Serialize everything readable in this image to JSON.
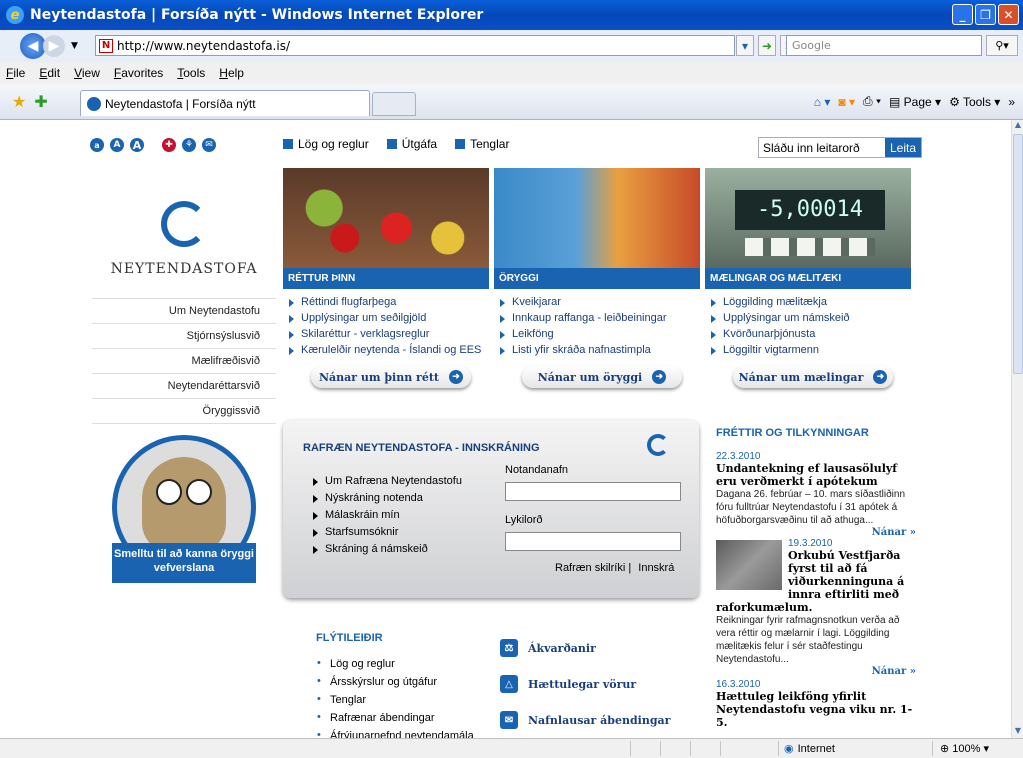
{
  "window": {
    "title": "Neytendastofa | Forsíða nýtt - Windows Internet Explorer",
    "ie_icon": "e"
  },
  "address": {
    "url": "http://www.neytendastofa.is/",
    "search_placeholder": "Google"
  },
  "menu": [
    "File",
    "Edit",
    "View",
    "Favorites",
    "Tools",
    "Help"
  ],
  "tab": {
    "title": "Neytendastofa | Forsíða nýtt"
  },
  "commandbar": {
    "page": "Page",
    "tools": "Tools"
  },
  "status": {
    "zone": "Internet",
    "zoom": "100%"
  },
  "site": {
    "accessibility_icons": [
      "a",
      "A",
      "A"
    ],
    "top_links": [
      "Lög og reglur",
      "Útgáfa",
      "Tenglar"
    ],
    "search_placeholder": "Sláðu inn leitarorð",
    "search_button": "Leita",
    "logo_name": "NEYTENDASTOFA",
    "sidenav": [
      "Um Neytendastofu",
      "Stjórnsýslusvið",
      "Mælifræðisvið",
      "Neytendaréttarsvið",
      "Öryggissvið"
    ],
    "owl_banner": "Smelltu til að kanna öryggi vefverslana",
    "columns": [
      {
        "head": "RÉTTUR ÞINN",
        "items": [
          "Réttindi flugfarþega",
          "Upplýsingar um seðilgjöld",
          "Skilaréttur - verklagsreglur",
          "Kærulelðir neytenda - Íslandi og EES"
        ],
        "more": "Nánar um þinn rétt"
      },
      {
        "head": "ÖRYGGI",
        "items": [
          "Kveikjarar",
          "Innkaup raffanga - leiðbeiningar",
          "Leikföng",
          "Listi yfir skráða nafnastimpla"
        ],
        "more": "Nánar um öryggi"
      },
      {
        "head": "MÆLINGAR OG MÆLITÆKI",
        "items": [
          "Löggilding mælitækja",
          "Upplýsingar um námskeið",
          "Kvörðunarþjónusta",
          "Löggiltir vigtarmenn"
        ],
        "more": "Nánar um mælingar"
      }
    ],
    "photo3_reading": "-5,00014",
    "login": {
      "title": "RAFRÆN NEYTENDASTOFA - INNSKRÁNING",
      "links": [
        "Um Rafræna Neytendastofu",
        "Nýskráning notenda",
        "Málaskráin mín",
        "Starfsumsóknir",
        "Skráning á námskeið"
      ],
      "user_label": "Notandanafn",
      "pass_label": "Lykilorð",
      "cert_link": "Rafræn skilríki |",
      "login_link": "Innskrá"
    },
    "shortcuts": {
      "title": "FLÝTILEIÐIR",
      "items": [
        "Lög og reglur",
        "Ársskýrslur og útgáfur",
        "Tenglar",
        "Rafrænar ábendingar",
        "Áfrýjunarnefnd neytendamála"
      ],
      "icons": [
        "Ákvarðanir",
        "Hættulegar vörur",
        "Nafnlausar ábendingar"
      ]
    },
    "news": {
      "title": "FRÉTTIR OG TILKYNNINGAR",
      "more": "Nánar »",
      "items": [
        {
          "date": "22.3.2010",
          "headline": "Undantekning ef lausasölulyf eru verðmerkt í apótekum",
          "body": "Dagana 26. febrúar – 10. mars síðastliðinn fóru fulltrúar Neytendastofu í 31 apótek á höfuðborgarsvæðinu til að athuga..."
        },
        {
          "date": "19.3.2010",
          "headline": "Orkubú Vestfjarða fyrst til að fá viðurkenninguna á innra eftirliti með raforkumælum.",
          "body": "Reikningar fyrir rafmagnsnotkun verða að vera réttir og mælarnir í lagi. Löggilding mælitækis felur í sér staðfestingu Neytendastofu..."
        },
        {
          "date": "16.3.2010",
          "headline": "Hættuleg leikföng yfirlit Neytendastofu vegna viku nr. 1- 5.",
          "body": ""
        }
      ]
    }
  }
}
